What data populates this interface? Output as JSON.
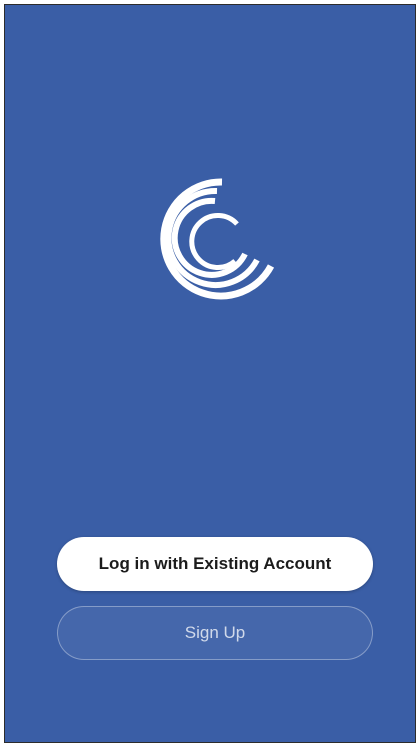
{
  "colors": {
    "background": "#3a5ea6",
    "primary_button_bg": "#ffffff",
    "primary_button_text": "#1c1c1c",
    "secondary_button_text": "#ffffffbf"
  },
  "logo": {
    "icon": "concentric-c-logo-icon"
  },
  "actions": {
    "login_label": "Log in with Existing Account",
    "signup_label": "Sign Up"
  }
}
